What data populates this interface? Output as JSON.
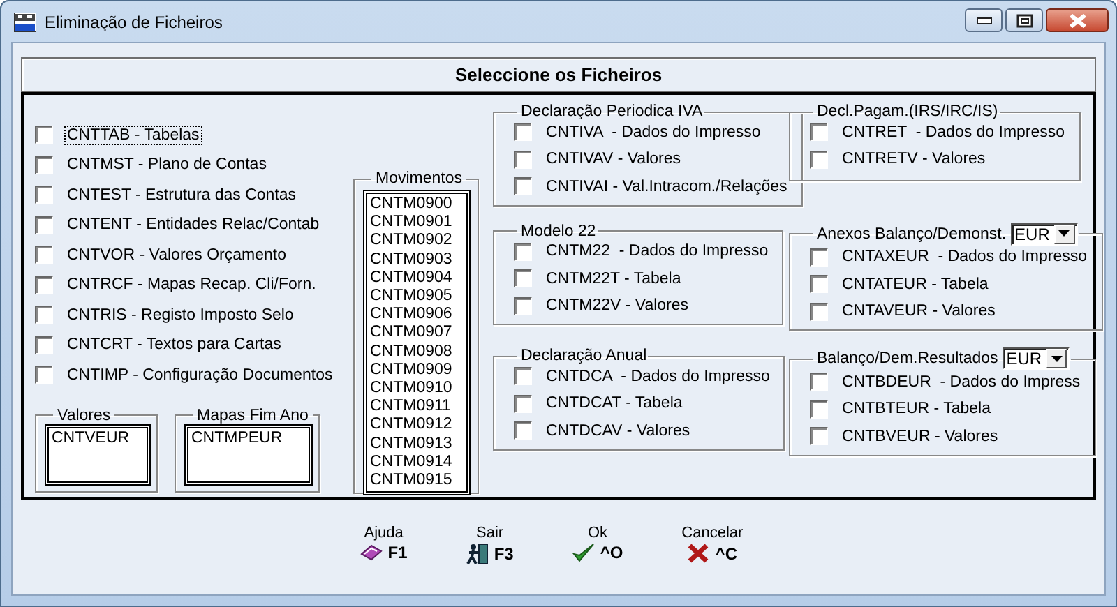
{
  "window": {
    "title": "Eliminação de Ficheiros"
  },
  "heading": "Seleccione os Ficheiros",
  "files": [
    {
      "label": "CNTTAB - Tabelas",
      "checked": false,
      "focused": true
    },
    {
      "label": "CNTMST - Plano de Contas",
      "checked": false,
      "focused": false
    },
    {
      "label": "CNTEST - Estrutura das Contas",
      "checked": false,
      "focused": false
    },
    {
      "label": "CNTENT - Entidades Relac/Contab",
      "checked": false,
      "focused": false
    },
    {
      "label": "CNTVOR - Valores Orçamento",
      "checked": false,
      "focused": false
    },
    {
      "label": "CNTRCF - Mapas Recap. Cli/Forn.",
      "checked": false,
      "focused": false
    },
    {
      "label": "CNTRIS - Registo Imposto Selo",
      "checked": false,
      "focused": false
    },
    {
      "label": "CNTCRT - Textos para Cartas",
      "checked": false,
      "focused": false
    },
    {
      "label": "CNTIMP - Configuração Documentos",
      "checked": false,
      "focused": false
    }
  ],
  "small_lists": [
    {
      "title": "Valores",
      "items": [
        "CNTVEUR"
      ]
    },
    {
      "title": "Mapas Fim Ano",
      "items": [
        "CNTMPEUR"
      ]
    }
  ],
  "movimentos": {
    "title": "Movimentos",
    "items": [
      "CNTM0900",
      "CNTM0901",
      "CNTM0902",
      "CNTM0903",
      "CNTM0904",
      "CNTM0905",
      "CNTM0906",
      "CNTM0907",
      "CNTM0908",
      "CNTM0909",
      "CNTM0910",
      "CNTM0911",
      "CNTM0912",
      "CNTM0913",
      "CNTM0914",
      "CNTM0915"
    ]
  },
  "groups": [
    {
      "title": "Declaração Periodica IVA",
      "items": [
        {
          "label": "CNTIVA  - Dados do Impresso",
          "checked": false
        },
        {
          "label": "CNTIVAV - Valores",
          "checked": false
        },
        {
          "label": "CNTIVAI - Val.Intracom./Relações",
          "checked": false
        }
      ]
    },
    {
      "title": "Decl.Pagam.(IRS/IRC/IS)",
      "items": [
        {
          "label": "CNTRET  - Dados do Impresso",
          "checked": false
        },
        {
          "label": "CNTRETV - Valores",
          "checked": false
        }
      ]
    },
    {
      "title": "Modelo 22",
      "items": [
        {
          "label": "CNTM22  - Dados do Impresso",
          "checked": false
        },
        {
          "label": "CNTM22T - Tabela",
          "checked": false
        },
        {
          "label": "CNTM22V - Valores",
          "checked": false
        }
      ]
    },
    {
      "title": "Anexos Balanço/Demonst.",
      "currency": "EUR",
      "items": [
        {
          "label": "CNTAXEUR  - Dados do Impresso",
          "checked": false
        },
        {
          "label": "CNTATEUR - Tabela",
          "checked": false
        },
        {
          "label": "CNTAVEUR - Valores",
          "checked": false
        }
      ]
    },
    {
      "title": "Declaração Anual",
      "items": [
        {
          "label": "CNTDCA  - Dados do Impresso",
          "checked": false
        },
        {
          "label": "CNTDCAT - Tabela",
          "checked": false
        },
        {
          "label": "CNTDCAV - Valores",
          "checked": false
        }
      ]
    },
    {
      "title": "Balanço/Dem.Resultados",
      "currency": "EUR",
      "items": [
        {
          "label": "CNTBDEUR  - Dados do Impress",
          "checked": false
        },
        {
          "label": "CNTBTEUR - Tabela",
          "checked": false
        },
        {
          "label": "CNTBVEUR - Valores",
          "checked": false
        }
      ]
    }
  ],
  "buttons": [
    {
      "kind": "help",
      "label": "Ajuda",
      "key": "F1"
    },
    {
      "kind": "exit",
      "label": "Sair",
      "key": "F3"
    },
    {
      "kind": "ok",
      "label": "Ok",
      "key": "^O"
    },
    {
      "kind": "cancel",
      "label": "Cancelar",
      "key": "^C"
    }
  ]
}
